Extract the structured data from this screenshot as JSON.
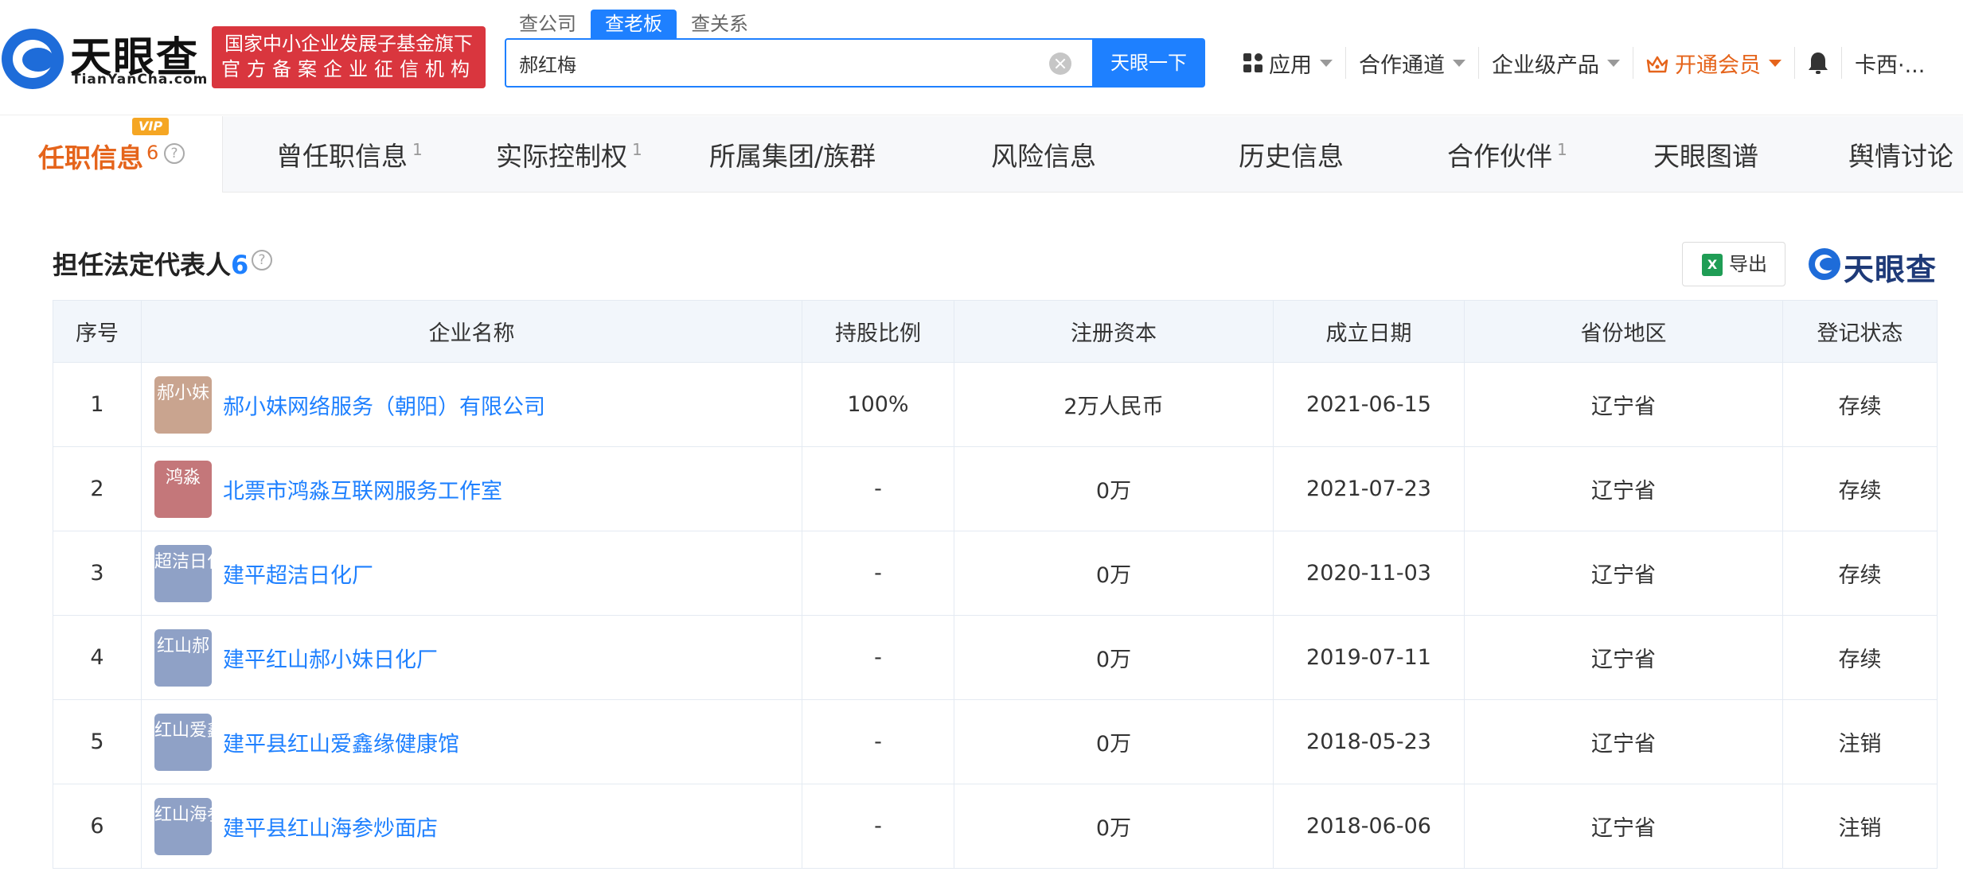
{
  "brand": {
    "name": "天眼查",
    "domain": "TianYanCha.com"
  },
  "gov_badge": {
    "line1": "国家中小企业发展子基金旗下",
    "line2": "官方备案企业征信机构"
  },
  "search": {
    "tabs": [
      {
        "label": "查公司",
        "active": false
      },
      {
        "label": "查老板",
        "active": true
      },
      {
        "label": "查关系",
        "active": false
      }
    ],
    "query": "郝红梅",
    "button_label": "天眼一下"
  },
  "top_nav": {
    "apps": "应用",
    "cooperation": "合作通道",
    "enterprise": "企业级产品",
    "vip": "开通会员",
    "user": "卡西·..."
  },
  "tabs": {
    "first": {
      "label": "任职信息",
      "count": "6",
      "vip_tag": "VIP"
    },
    "items": [
      {
        "label": "曾任职信息",
        "count": "1"
      },
      {
        "label": "实际控制权",
        "count": "1"
      },
      {
        "label": "所属集团/族群",
        "count": ""
      },
      {
        "label": "风险信息",
        "count": ""
      },
      {
        "label": "历史信息",
        "count": ""
      },
      {
        "label": "合作伙伴",
        "count": "1"
      },
      {
        "label": "天眼图谱",
        "count": ""
      },
      {
        "label": "舆情讨论",
        "count": ""
      }
    ]
  },
  "section": {
    "title": "担任法定代表人",
    "count": "6",
    "export_label": "导出",
    "brand_mini": "天眼查"
  },
  "table": {
    "headers": [
      "序号",
      "企业名称",
      "持股比例",
      "注册资本",
      "成立日期",
      "省份地区",
      "登记状态"
    ],
    "rows": [
      {
        "no": "1",
        "logo_text": "郝小妹",
        "logo_color": "#c9a48f",
        "name": "郝小妹网络服务（朝阳）有限公司",
        "share": "100%",
        "capital": "2万人民币",
        "date": "2021-06-15",
        "region": "辽宁省",
        "status": "存续",
        "status_type": "active"
      },
      {
        "no": "2",
        "logo_text": "鸿淼",
        "logo_color": "#c4777a",
        "name": "北票市鸿淼互联网服务工作室",
        "share": "-",
        "capital": "0万",
        "date": "2021-07-23",
        "region": "辽宁省",
        "status": "存续",
        "status_type": "active"
      },
      {
        "no": "3",
        "logo_text": "超洁日化",
        "logo_color": "#8fa1c6",
        "name": "建平超洁日化厂",
        "share": "-",
        "capital": "0万",
        "date": "2020-11-03",
        "region": "辽宁省",
        "status": "存续",
        "status_type": "active"
      },
      {
        "no": "4",
        "logo_text": "红山郝",
        "logo_color": "#8fa1c6",
        "name": "建平红山郝小妹日化厂",
        "share": "-",
        "capital": "0万",
        "date": "2019-07-11",
        "region": "辽宁省",
        "status": "存续",
        "status_type": "active"
      },
      {
        "no": "5",
        "logo_text": "红山爱鑫",
        "logo_color": "#8fa1c6",
        "name": "建平县红山爱鑫缘健康馆",
        "share": "-",
        "capital": "0万",
        "date": "2018-05-23",
        "region": "辽宁省",
        "status": "注销",
        "status_type": "cancel"
      },
      {
        "no": "6",
        "logo_text": "红山海参",
        "logo_color": "#8fa1c6",
        "name": "建平县红山海参炒面店",
        "share": "-",
        "capital": "0万",
        "date": "2018-06-06",
        "region": "辽宁省",
        "status": "注销",
        "status_type": "cancel"
      }
    ]
  },
  "colors": {
    "primary": "#1e80ff",
    "accent_orange": "#e5641b",
    "badge_red": "#d9363e",
    "status_active": "#3a9c3a",
    "status_cancel": "#e64545"
  }
}
